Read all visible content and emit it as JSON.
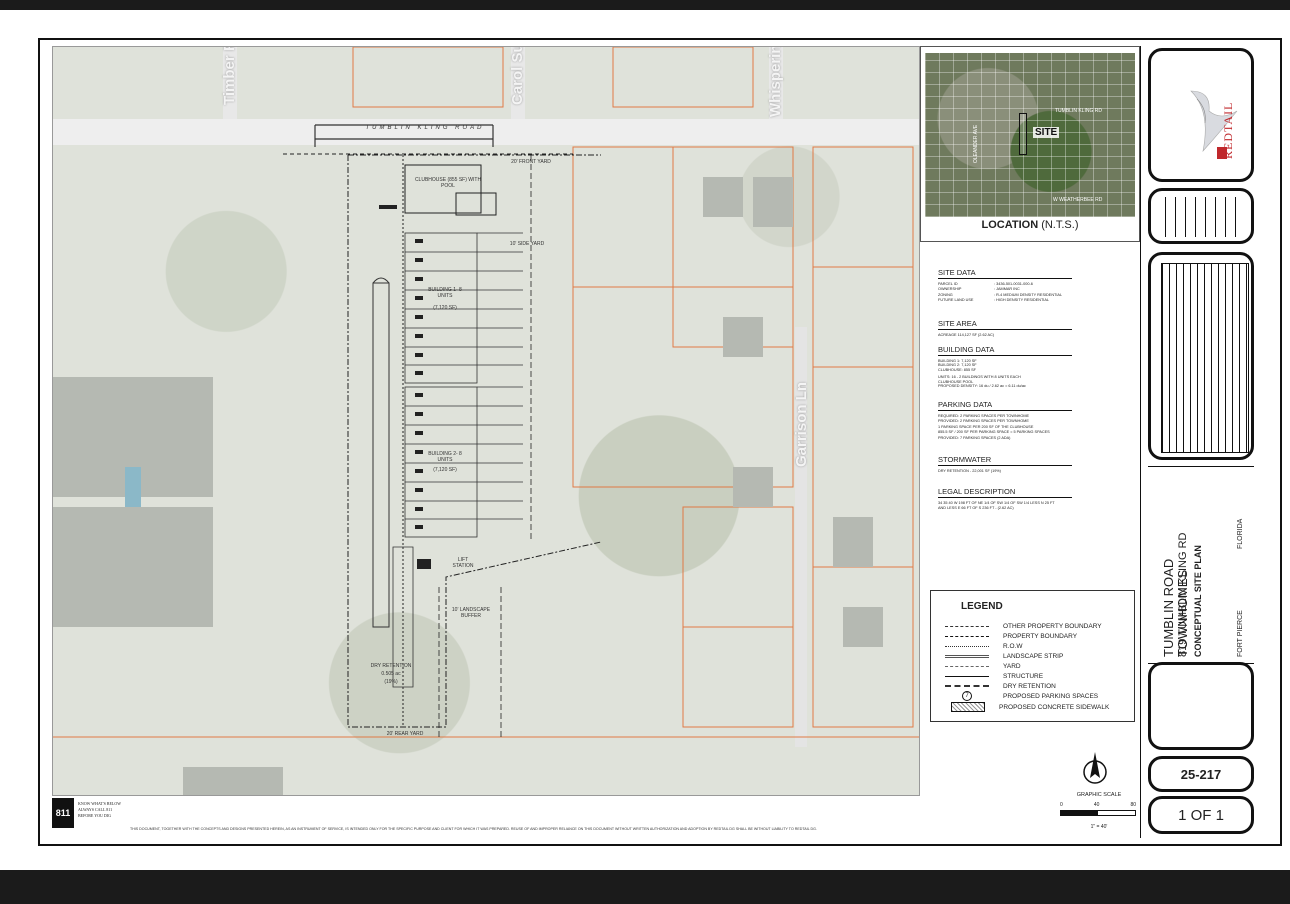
{
  "streets": {
    "timber_ridge": "Timber Ridge Ln",
    "carol_susan": "Carol Susan Ln",
    "whispering_pines": "Whispering Pines Ln",
    "garrison": "Garrison Ln",
    "tumblin_kling": "TUMBLIN KLING ROAD"
  },
  "plan_labels": {
    "clubhouse": "CLUBHOUSE (855 SF) WITH POOL",
    "building1": "BUILDING 1- 8 UNITS",
    "building1_sf": "(7,120 SF)",
    "building2": "BUILDING 2- 8 UNITS",
    "building2_sf": "(7,120 SF)",
    "dry_retention": "DRY RETENTION",
    "dry_retention_area": "0.505 ac",
    "dry_retention_pct": "(19%)",
    "landscape_buffer": "10' LANDSCAPE BUFFER",
    "side_yard": "10' SIDE YARD",
    "rear_yard": "20' REAR YARD",
    "front_yard": "20' FRONT YARD",
    "lift_station": "LIFT STATION"
  },
  "location": {
    "caption": "LOCATION",
    "nts": "(N.T.S.)",
    "site": "SITE",
    "tumblin_kling_rd": "TUMBLIN KLING RD",
    "w_weatherbee_rd": "W WEATHERBEE RD",
    "oleander_ave": "OLEANDER AVE"
  },
  "site_data": {
    "heading": "SITE DATA",
    "rows": [
      {
        "k": "PARCEL ID",
        "v": ": 3436-501-0031-000-6"
      },
      {
        "k": "OWNERSHIP",
        "v": ": JAMMAR INC"
      },
      {
        "k": "ZONING",
        "v": ": R-4 MEDIUM DENSITY RESIDENTIAL"
      },
      {
        "k": "FUTURE LAND USE",
        "v": ": HIGH DENSITY RESIDENTIAL"
      }
    ]
  },
  "site_area": {
    "heading": "SITE AREA",
    "line": "ACREAGE 114,127 SF (2.62 AC)"
  },
  "building_data": {
    "heading": "BUILDING DATA",
    "lines": [
      "BUILDING 1: 7,120 SF",
      "BUILDING 2: 7,120 SF",
      "CLUBHOUSE: 855 SF",
      "",
      "UNITS: 16 - 2 BUILDINGS WITH 8 UNITS EACH",
      "CLUBHOUSE POOL",
      "PROPOSED DENSITY: 16 du / 2.62 ac = 6.11 du/ac"
    ]
  },
  "parking_data": {
    "heading": "PARKING DATA",
    "lines": [
      "REQUIRED: 2 PARKING SPACES PER TOWNHOME",
      "PROVIDED: 2 PARKING SPACES PER TOWNHOME",
      "1 PARKING SPACE PER 200 SF OF THE CLUBHOUSE",
      "855.5 SF / 200 SF PER PARKING SPACE = 5 PARKING SPACES",
      "PROVIDED: 7 PARKING SPACES (2 ADA)"
    ]
  },
  "stormwater": {
    "heading": "STORMWATER",
    "line": "DRY RETENTION - 22,001 SF (19%)"
  },
  "legal": {
    "heading": "LEGAL DESCRIPTION",
    "lines": [
      "34 35 40 W 198 FT OF NE 1/4 OF SW 1/4 OF SW 1/4 LESS N 25 FT",
      "AND LESS E 66 FT OF S 236 FT - (2.62 AC)"
    ]
  },
  "legend": {
    "title": "LEGEND",
    "items": [
      "OTHER PROPERTY BOUNDARY",
      "PROPERTY BOUNDARY",
      "R.O.W",
      "LANDSCAPE STRIP",
      "YARD",
      "STRUCTURE",
      "DRY RETENTION",
      "PROPOSED PARKING SPACES",
      "PROPOSED CONCRETE SIDEWALK"
    ],
    "parking_symbol": "7"
  },
  "scale": {
    "label": "GRAPHIC SCALE",
    "ticks": [
      "0",
      "40",
      "80"
    ],
    "ratio": "1\" = 40'"
  },
  "title_block": {
    "project": "TUMBLIN ROAD TOWNHOMES",
    "address": "819 TUMBLIN KLING RD",
    "sheet_title": "CONCEPTUAL SITE PLAN",
    "city": "FORT PIERCE",
    "state": "FLORIDA",
    "job_number": "25-217",
    "sheet_number": "1 OF 1",
    "logo_text": "REDTAIL"
  },
  "logo811": {
    "number": "811",
    "text1": "KNOW WHAT'S BELOW",
    "text2": "ALWAYS CALL 811",
    "text3": "BEFORE YOU DIG"
  },
  "disclaimer": "THIS DOCUMENT, TOGETHER WITH THE CONCEPTS AND DESIGNS PRESENTED HEREIN, AS AN INSTRUMENT OF SERVICE, IS INTENDED ONLY FOR THE SPECIFIC PURPOSE AND CLIENT FOR WHICH IT WAS PREPARED. REUSE OF AND IMPROPER RELIANCE ON THIS DOCUMENT WITHOUT WRITTEN AUTHORIZATION AND ADOPTION BY REDTAIL DG SHALL BE WITHOUT LIABILITY TO REDTAIL DG.",
  "colors": {
    "property_line": "#e07a45",
    "brand_red": "#c0282c",
    "ink": "#111111"
  }
}
